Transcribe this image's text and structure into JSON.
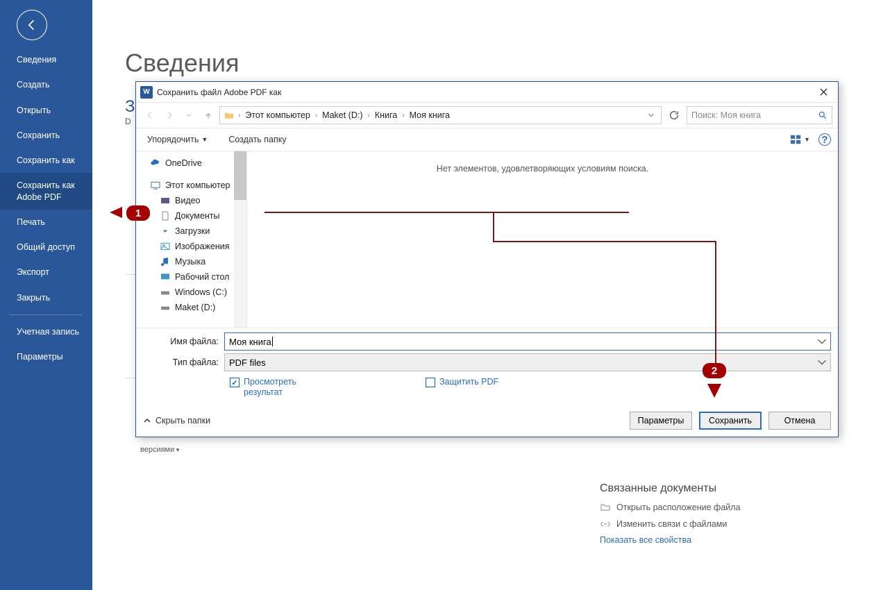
{
  "sidebar": {
    "items": [
      "Сведения",
      "Создать",
      "Открыть",
      "Сохранить",
      "Сохранить как",
      "Сохранить как Adobe PDF",
      "Печать",
      "Общий доступ",
      "Экспорт",
      "Закрыть"
    ],
    "selected_index": 5,
    "account": "Учетная запись",
    "params": "Параметры"
  },
  "page": {
    "title": "Сведения",
    "doc_prefix": "З",
    "dpath": "D",
    "versions_btn": "версиями"
  },
  "related": {
    "heading": "Связанные документы",
    "open_loc": "Открыть расположение файла",
    "edit_links": "Изменить связи с файлами",
    "show_all": "Показать все свойства"
  },
  "dialog": {
    "title": "Сохранить файл Adobe PDF как",
    "breadcrumb": [
      "Этот компьютер",
      "Maket (D:)",
      "Книга",
      "Моя книга"
    ],
    "search_placeholder": "Поиск: Моя книга",
    "toolbar": {
      "organize": "Упорядочить",
      "new_folder": "Создать папку"
    },
    "tree": [
      {
        "label": "OneDrive",
        "icon": "cloud",
        "indent": 0
      },
      {
        "label": "Этот компьютер",
        "icon": "pc",
        "indent": 0
      },
      {
        "label": "Видео",
        "icon": "video",
        "indent": 1
      },
      {
        "label": "Документы",
        "icon": "doc",
        "indent": 1
      },
      {
        "label": "Загрузки",
        "icon": "download",
        "indent": 1
      },
      {
        "label": "Изображения",
        "icon": "image",
        "indent": 1
      },
      {
        "label": "Музыка",
        "icon": "music",
        "indent": 1
      },
      {
        "label": "Рабочий стол",
        "icon": "desktop",
        "indent": 1
      },
      {
        "label": "Windows (C:)",
        "icon": "drive",
        "indent": 1
      },
      {
        "label": "Maket (D:)",
        "icon": "drive",
        "indent": 1
      }
    ],
    "empty_msg": "Нет элементов, удовлетворяющих условиям поиска.",
    "fields": {
      "filename_label": "Имя файла:",
      "filename_value": "Моя книга",
      "filetype_label": "Тип файла:",
      "filetype_value": "PDF files"
    },
    "checks": {
      "preview": "Просмотреть результат",
      "protect": "Защитить PDF"
    },
    "hide_folders": "Скрыть папки",
    "buttons": {
      "params": "Параметры",
      "save": "Сохранить",
      "cancel": "Отмена"
    }
  },
  "callouts": {
    "1": "1",
    "2": "2"
  }
}
